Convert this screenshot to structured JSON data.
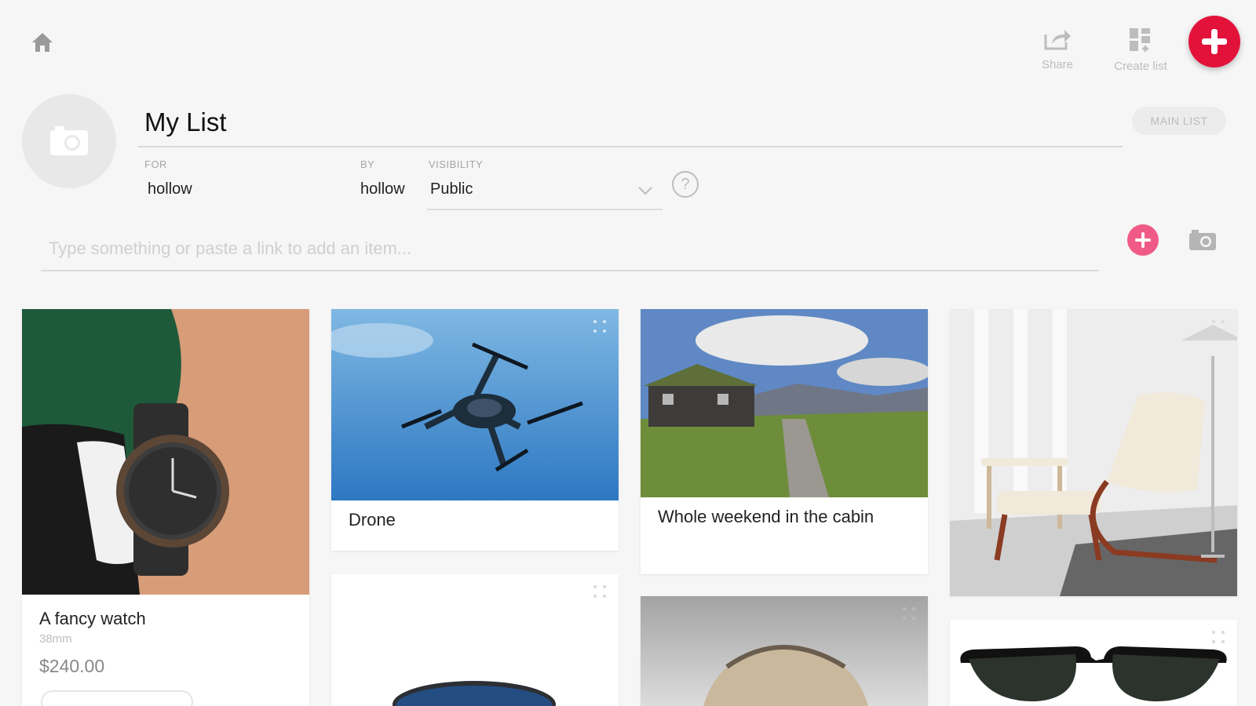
{
  "header": {
    "share_label": "Share",
    "create_list_label": "Create list"
  },
  "list": {
    "title": "My List",
    "badge": "MAIN LIST",
    "for_label": "FOR",
    "for_value": "hollow",
    "by_label": "BY",
    "by_value": "hollow",
    "visibility_label": "VISIBILITY",
    "visibility_value": "Public",
    "help_glyph": "?"
  },
  "add_item": {
    "placeholder": "Type something or paste a link to add an item..."
  },
  "items": [
    {
      "name": "A fancy watch",
      "detail": "38mm",
      "price": "$240.00",
      "icon": "wristwatch-photo"
    },
    {
      "name": "Drone",
      "icon": "drone-photo"
    },
    {
      "name": "Whole weekend in the cabin",
      "icon": "cabin-landscape-photo"
    },
    {
      "name": "",
      "icon": "armchair-photo"
    },
    {
      "name": "",
      "icon": "smart-speaker-photo"
    },
    {
      "name": "",
      "icon": "handbag-photo"
    },
    {
      "name": "",
      "icon": "sunglasses-photo"
    }
  ],
  "colors": {
    "accent": "#e3123b",
    "add_button": "#f05a86",
    "background": "#f6f6f6"
  }
}
